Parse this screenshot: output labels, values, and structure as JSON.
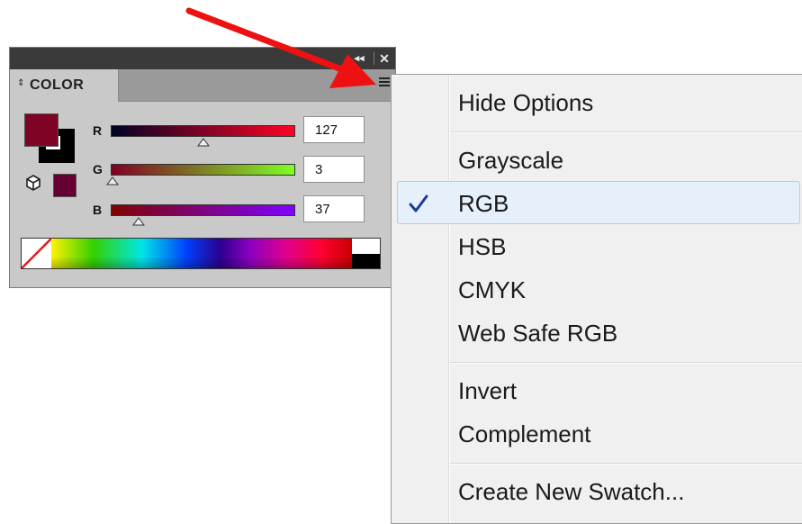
{
  "panel": {
    "title": "COLOR",
    "tab_arrows": "⇕",
    "collapse_glyph": "◂◂",
    "close_glyph": "✕",
    "menu_icon": "hamburger-menu-icon",
    "fill_color": "#7f0325",
    "websafe_color": "#660033",
    "channels": [
      {
        "label": "R",
        "value": "127",
        "level": 0.5
      },
      {
        "label": "G",
        "value": "3",
        "level": 0.01
      },
      {
        "label": "B",
        "value": "37",
        "level": 0.15
      }
    ]
  },
  "menu": {
    "items": [
      {
        "label": "Hide Options"
      },
      {
        "label": "Grayscale"
      },
      {
        "label": "RGB",
        "checked": true
      },
      {
        "label": "HSB"
      },
      {
        "label": "CMYK"
      },
      {
        "label": "Web Safe RGB"
      },
      {
        "label": "Invert"
      },
      {
        "label": "Complement"
      },
      {
        "label": "Create New Swatch..."
      }
    ],
    "check_glyph": "✓"
  },
  "colors": {
    "arrow": "#ee1111",
    "highlight": "#e6f0fb",
    "check": "#1a3a9c"
  }
}
